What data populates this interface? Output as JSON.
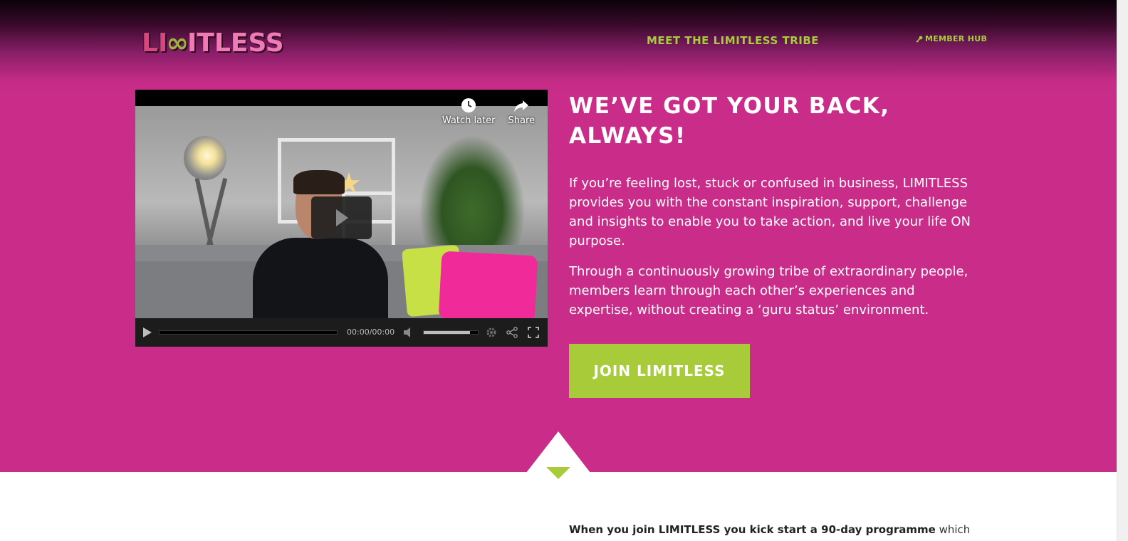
{
  "colors": {
    "brand_pink": "#c92d89",
    "accent_green": "#a8cb3a",
    "text_white": "#ffffff"
  },
  "header": {
    "logo_text": "LIMITLESS",
    "nav": {
      "tribe": "MEET THE LIMITLESS TRIBE",
      "member_hub": "MEMBER HUB"
    }
  },
  "video": {
    "watch_later": "Watch later",
    "share": "Share",
    "time": "00:00/00:00",
    "volume_level": 0.85,
    "icons": [
      "clock-icon",
      "share-arrow-icon",
      "play-icon",
      "volume-icon",
      "gear-icon",
      "share-icon",
      "fullscreen-icon"
    ]
  },
  "hero": {
    "headline": "WE’VE GOT YOUR BACK, ALWAYS!",
    "para1": "If you’re feeling lost, stuck or confused in business, LIMITLESS provides you with the constant inspiration, support, challenge and insights to enable you to take action, and live your life ON purpose.",
    "para2": "Through a continuously growing tribe of extraordinary people, members learn through each other’s experiences  and expertise, without creating a ‘guru status’ environment.",
    "cta": "JOIN LIMITLESS"
  },
  "bottom": {
    "lead_bold": "When you join LIMITLESS you kick start a 90-day programme",
    "lead_rest": " which"
  }
}
